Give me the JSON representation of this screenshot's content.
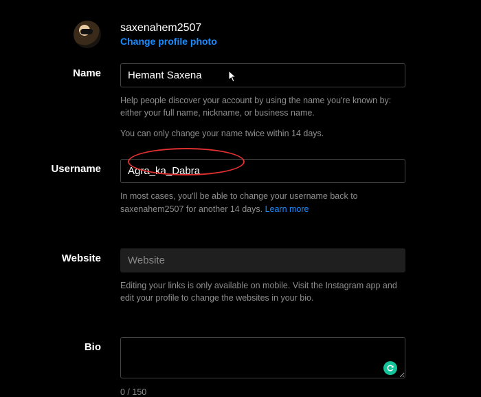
{
  "header": {
    "username": "saxenahem2507",
    "change_photo": "Change profile photo"
  },
  "name": {
    "label": "Name",
    "value": "Hemant Saxena",
    "help1": "Help people discover your account by using the name you're known by: either your full name, nickname, or business name.",
    "help2": "You can only change your name twice within 14 days."
  },
  "username": {
    "label": "Username",
    "value": "Agra_ka_Dabra",
    "help": "In most cases, you'll be able to change your username back to saxenahem2507 for another 14 days. ",
    "learn_more": "Learn more"
  },
  "website": {
    "label": "Website",
    "placeholder": "Website",
    "help": "Editing your links is only available on mobile. Visit the Instagram app and edit your profile to change the websites in your bio."
  },
  "bio": {
    "label": "Bio",
    "value": "",
    "counter": "0 / 150"
  }
}
